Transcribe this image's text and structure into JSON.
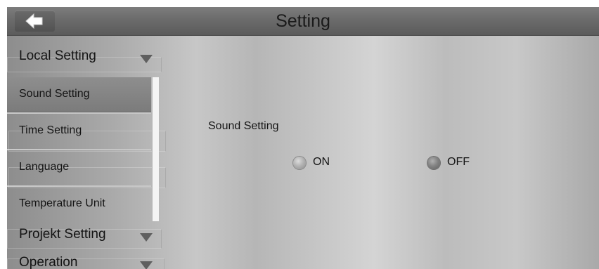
{
  "header": {
    "title": "Setting",
    "back_icon": "arrow-left-icon"
  },
  "sidebar": {
    "sections": [
      {
        "label": "Local Setting",
        "icon": "triangle-down-icon",
        "expanded": true
      },
      {
        "label": "Projekt Setting",
        "icon": "triangle-down-icon",
        "expanded": false
      },
      {
        "label": "Operation",
        "icon": "triangle-down-icon",
        "expanded": false
      }
    ],
    "items": [
      {
        "label": "Sound Setting",
        "selected": true
      },
      {
        "label": "Time Setting",
        "selected": false
      },
      {
        "label": "Language",
        "selected": false
      },
      {
        "label": "Temperature Unit",
        "selected": false
      }
    ]
  },
  "main": {
    "setting_label": "Sound Setting",
    "options": [
      {
        "label": "ON",
        "selected": false
      },
      {
        "label": "OFF",
        "selected": false
      }
    ]
  },
  "colors": {
    "header_bg": "#6b6b6b",
    "selected_item_bg": "#858585",
    "text": "#141414"
  }
}
